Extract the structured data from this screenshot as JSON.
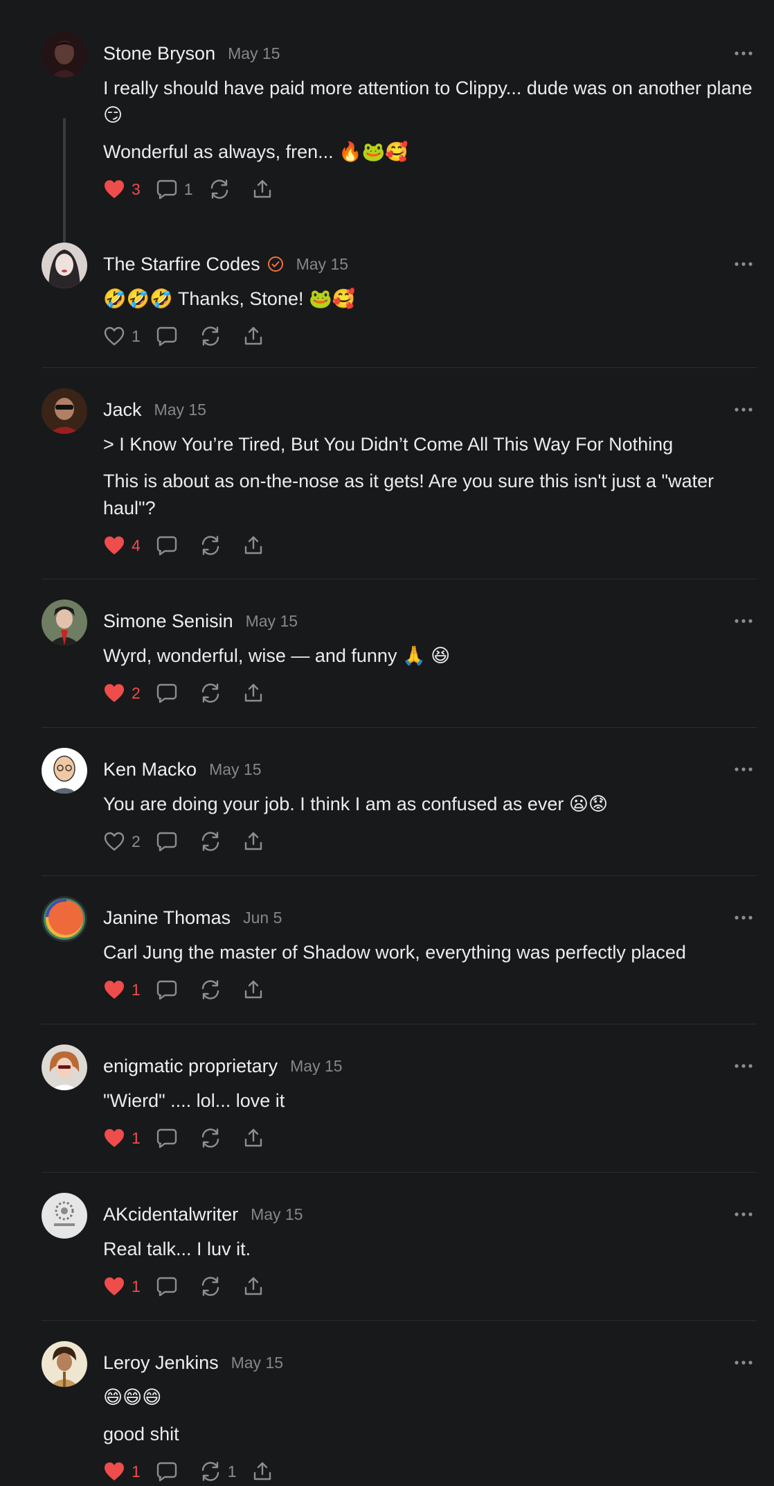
{
  "colors": {
    "background": "#18191b",
    "liked": "#ef4c4c",
    "muted": "#86878b",
    "verified": "#f0713b"
  },
  "comments": [
    {
      "name": "Stone Bryson",
      "date": "May 15",
      "lines": [
        "I really should have paid more attention to Clippy... dude was on another plane 😏",
        "Wonderful as always, fren... 🔥🐸🥰"
      ],
      "likes": "3",
      "liked": true,
      "replies": "1",
      "restacks": ""
    },
    {
      "name": "The Starfire Codes",
      "date": "May 15",
      "verified": true,
      "lines": [
        "🤣🤣🤣 Thanks, Stone! 🐸🥰"
      ],
      "likes": "1",
      "liked": false,
      "replies": "",
      "restacks": ""
    },
    {
      "name": "Jack",
      "date": "May 15",
      "lines": [
        "> I Know You’re Tired, But You Didn’t Come All This Way For Nothing",
        "This is about as on-the-nose as it gets! Are you sure this isn't just a \"water haul\"?"
      ],
      "likes": "4",
      "liked": true,
      "replies": "",
      "restacks": ""
    },
    {
      "name": "Simone Senisin",
      "date": "May 15",
      "lines": [
        "Wyrd, wonderful, wise — and funny 🙏 😆"
      ],
      "likes": "2",
      "liked": true,
      "replies": "",
      "restacks": ""
    },
    {
      "name": "Ken Macko",
      "date": "May 15",
      "lines": [
        "You are doing your job. I think I am as confused as ever 😦😟"
      ],
      "likes": "2",
      "liked": false,
      "replies": "",
      "restacks": ""
    },
    {
      "name": "Janine Thomas",
      "date": "Jun 5",
      "lines": [
        "Carl Jung the master of Shadow work, everything was perfectly placed"
      ],
      "likes": "1",
      "liked": true,
      "replies": "",
      "restacks": ""
    },
    {
      "name": "enigmatic proprietary",
      "date": "May 15",
      "lines": [
        "\"Wierd\" .... lol... love it"
      ],
      "likes": "1",
      "liked": true,
      "replies": "",
      "restacks": ""
    },
    {
      "name": "AKcidentalwriter",
      "date": "May 15",
      "lines": [
        "Real talk... I luv it."
      ],
      "likes": "1",
      "liked": true,
      "replies": "",
      "restacks": ""
    },
    {
      "name": "Leroy Jenkins",
      "date": "May 15",
      "lines": [
        "😄😄😄",
        "good shit"
      ],
      "likes": "1",
      "liked": true,
      "replies": "",
      "restacks": "1"
    }
  ]
}
